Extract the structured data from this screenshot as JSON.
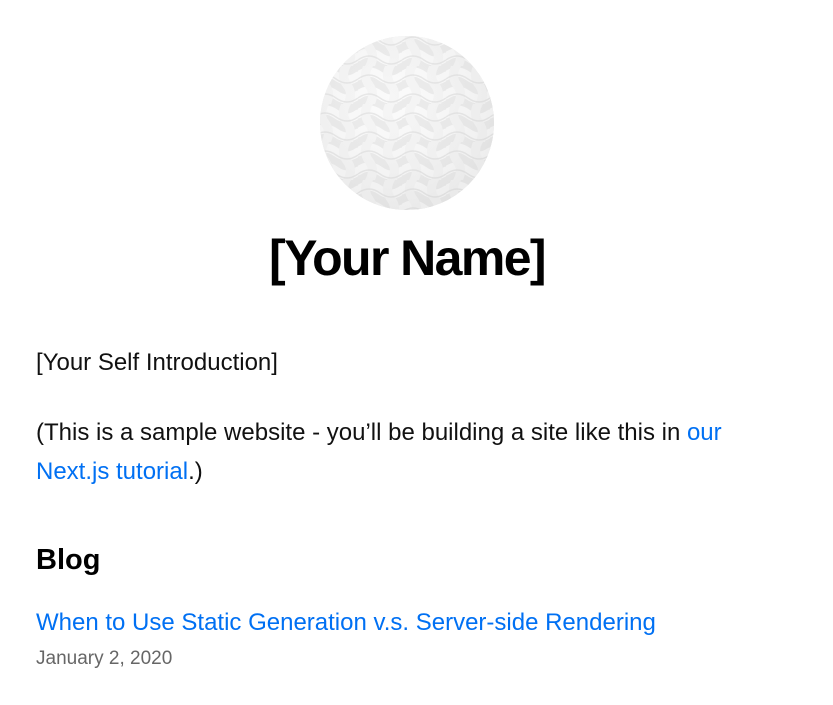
{
  "profile": {
    "name": "[Your Name]",
    "intro": "[Your Self Introduction]"
  },
  "sample_note": {
    "prefix": "(This is a sample website - you’ll be building a site like this in ",
    "link_text": "our Next.js tutorial",
    "suffix": ".)"
  },
  "blog": {
    "heading": "Blog",
    "posts": [
      {
        "title": "When to Use Static Generation v.s. Server-side Rendering",
        "date": "January 2, 2020"
      }
    ]
  },
  "colors": {
    "link": "#0070f3",
    "muted": "#666666",
    "text": "#111111"
  },
  "icons": {
    "avatar": "woven-pattern-avatar"
  }
}
